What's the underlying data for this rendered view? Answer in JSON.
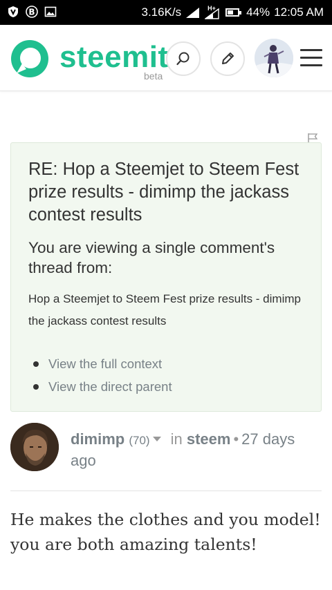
{
  "status_bar": {
    "left_icons": [
      "shield-v-icon",
      "bitcoin-icon",
      "image-icon"
    ],
    "speed": "3.16K/s",
    "signal_label": "H+",
    "battery": "44%",
    "time": "12:05 AM"
  },
  "header": {
    "brand": "steemit",
    "beta_label": "beta",
    "brand_color": "#1fbf8f"
  },
  "card": {
    "title": "RE: Hop a Steemjet to Steem Fest prize results - dimimp the jackass contest results",
    "subtitle": "You are viewing a single comment's thread from:",
    "link_text": "Hop a Steemjet to Steem Fest prize results - dimimp the jackass contest results",
    "links": [
      {
        "label": "View the full context"
      },
      {
        "label": "View the direct parent"
      }
    ],
    "background": "#f2f8f0"
  },
  "comment": {
    "author": "dimimp",
    "reputation": "(70)",
    "in_label": "in",
    "community": "steem",
    "separator": "•",
    "time_ago": "27 days ago",
    "body": "He makes the clothes and you model! you are both amazing talents!"
  }
}
